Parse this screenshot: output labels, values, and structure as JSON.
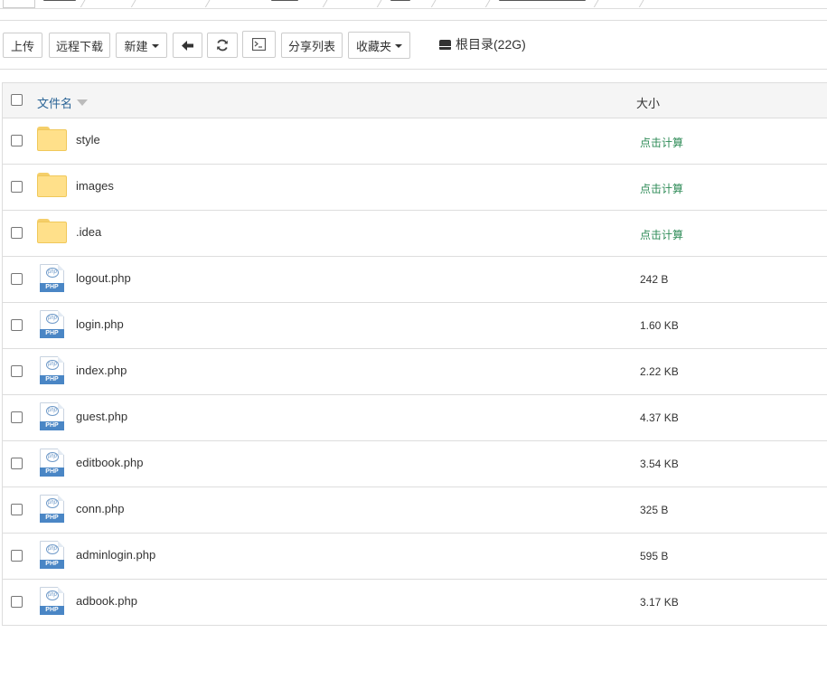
{
  "toolbar": {
    "upload_label": "上传",
    "remote_download_label": "远程下载",
    "new_label": "新建",
    "share_list_label": "分享列表",
    "favorites_label": "收藏夹",
    "root_label": "根目录(22G)"
  },
  "table": {
    "header_name": "文件名",
    "header_size": "大小",
    "rows": [
      {
        "name": "style",
        "type": "folder",
        "size": "点击计算"
      },
      {
        "name": "images",
        "type": "folder",
        "size": "点击计算"
      },
      {
        "name": ".idea",
        "type": "folder",
        "size": "点击计算"
      },
      {
        "name": "logout.php",
        "type": "php",
        "size": "242 B"
      },
      {
        "name": "login.php",
        "type": "php",
        "size": "1.60 KB"
      },
      {
        "name": "index.php",
        "type": "php",
        "size": "2.22 KB"
      },
      {
        "name": "guest.php",
        "type": "php",
        "size": "4.37 KB"
      },
      {
        "name": "editbook.php",
        "type": "php",
        "size": "3.54 KB"
      },
      {
        "name": "conn.php",
        "type": "php",
        "size": "325 B"
      },
      {
        "name": "adminlogin.php",
        "type": "php",
        "size": "595 B"
      },
      {
        "name": "adbook.php",
        "type": "php",
        "size": "3.17 KB"
      }
    ]
  },
  "icons": {
    "folder": "folder-icon",
    "php": "php-file-icon",
    "php_badge": "PHP",
    "php_logo": "php"
  },
  "colors": {
    "link": "#2a6496",
    "calc": "#2e8b57",
    "folder": "#ffe08a",
    "php_badge": "#4a86c5"
  }
}
